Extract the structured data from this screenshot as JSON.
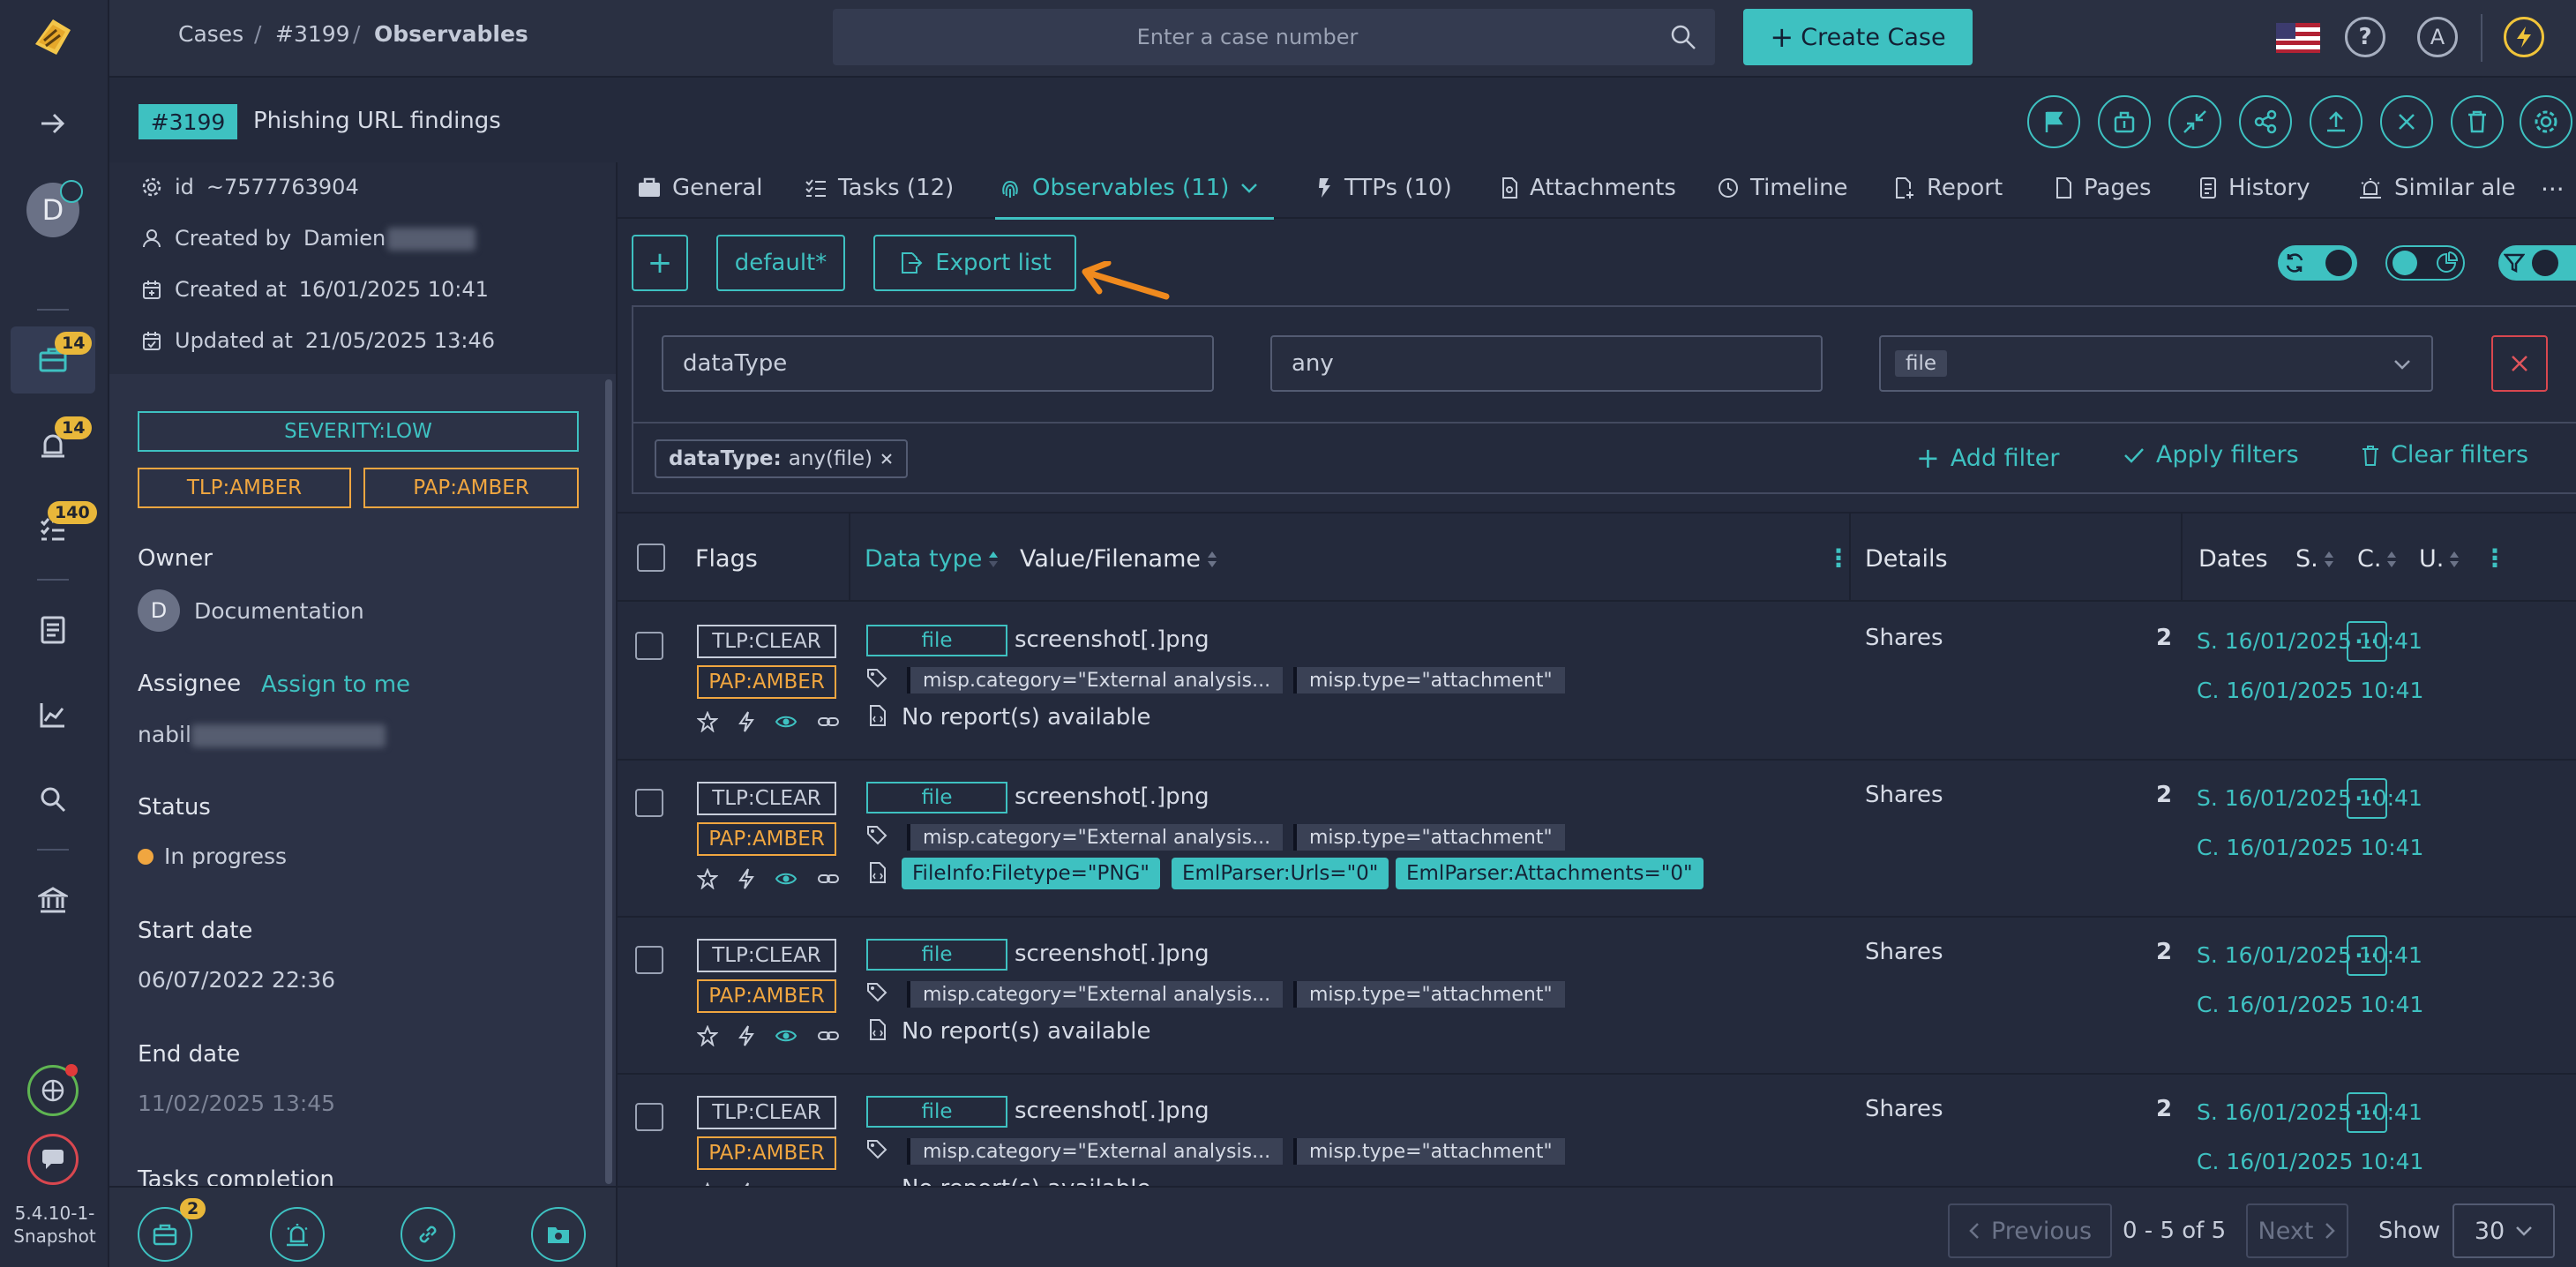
{
  "nav": {
    "breadcrumb": [
      "Cases",
      "/",
      "#3199",
      "/",
      "Observables"
    ],
    "search_placeholder": "Enter a case number",
    "create_case": "Create Case",
    "avatar_letter": "A",
    "badges": {
      "cases": "14",
      "alerts": "14",
      "tasks": "140"
    },
    "user_letter": "D",
    "version": "5.4.10-1-Snapshot",
    "footer_badge": "2"
  },
  "case": {
    "number": "#3199",
    "title": "Phishing URL findings",
    "id": "~7577763904",
    "created_by_label": "Created by",
    "created_by": "Damien",
    "created_at_label": "Created at",
    "created_at": "16/01/2025 10:41",
    "updated_at_label": "Updated at",
    "updated_at": "21/05/2025 13:46",
    "severity": "SEVERITY:LOW",
    "tlp": "TLP:AMBER",
    "pap": "PAP:AMBER",
    "owner_label": "Owner",
    "owner_letter": "D",
    "owner": "Documentation",
    "assignee_label": "Assignee",
    "assign_to_me": "Assign to me",
    "assignee": "nabil",
    "status_label": "Status",
    "status": "In progress",
    "start_date_label": "Start date",
    "start_date": "06/07/2022 22:36",
    "end_date_label": "End date",
    "end_date": "11/02/2025 13:45",
    "tasks_completion_label": "Tasks completion"
  },
  "tabs": [
    {
      "label": "General"
    },
    {
      "label": "Tasks (12)"
    },
    {
      "label": "Observables (11)"
    },
    {
      "label": "TTPs (10)"
    },
    {
      "label": "Attachments"
    },
    {
      "label": "Timeline"
    },
    {
      "label": "Report"
    },
    {
      "label": "Pages"
    },
    {
      "label": "History"
    },
    {
      "label": "Similar ale"
    }
  ],
  "toolbar": {
    "add": "+",
    "preset": "default*",
    "export": "Export list"
  },
  "filter": {
    "field": "dataType",
    "operator": "any",
    "value": "file",
    "chip_key": "dataType:",
    "chip_value": "any(file)",
    "add_filter": "Add filter",
    "apply_filters": "Apply filters",
    "clear_filters": "Clear filters"
  },
  "table": {
    "headers": {
      "flags": "Flags",
      "data_type": "Data type",
      "value": "Value/Filename",
      "details": "Details",
      "dates": "Dates",
      "s": "S.",
      "c": "C.",
      "u": "U."
    },
    "rows": [
      {
        "tlp": "TLP:CLEAR",
        "pap": "PAP:AMBER",
        "type": "file",
        "name": "screenshot[.]png",
        "tag1": "misp.category=\"External analysis...",
        "tag2": "misp.type=\"attachment\"",
        "report": "No report(s) available",
        "shares_label": "Shares",
        "shares": "2",
        "s_date": "S. 16/01/2025 10:41",
        "c_date": "C. 16/01/2025 10:41"
      },
      {
        "tlp": "TLP:CLEAR",
        "pap": "PAP:AMBER",
        "type": "file",
        "name": "screenshot[.]png",
        "tag1": "misp.category=\"External analysis...",
        "tag2": "misp.type=\"attachment\"",
        "reports": [
          "FileInfo:Filetype=\"PNG\"",
          "EmlParser:Urls=\"0\"",
          "EmlParser:Attachments=\"0\""
        ],
        "shares_label": "Shares",
        "shares": "2",
        "s_date": "S. 16/01/2025 10:41",
        "c_date": "C. 16/01/2025 10:41"
      },
      {
        "tlp": "TLP:CLEAR",
        "pap": "PAP:AMBER",
        "type": "file",
        "name": "screenshot[.]png",
        "tag1": "misp.category=\"External analysis...",
        "tag2": "misp.type=\"attachment\"",
        "report": "No report(s) available",
        "shares_label": "Shares",
        "shares": "2",
        "s_date": "S. 16/01/2025 10:41",
        "c_date": "C. 16/01/2025 10:41"
      },
      {
        "tlp": "TLP:CLEAR",
        "pap": "PAP:AMBER",
        "type": "file",
        "name": "screenshot[.]png",
        "tag1": "misp.category=\"External analysis...",
        "tag2": "misp.type=\"attachment\"",
        "report": "No report(s) available",
        "shares_label": "Shares",
        "shares": "2",
        "s_date": "S. 16/01/2025 10:41",
        "c_date": "C. 16/01/2025 10:41"
      }
    ]
  },
  "pagination": {
    "previous": "Previous",
    "range": "0 - 5 of 5",
    "next": "Next",
    "show_label": "Show",
    "page_size": "30"
  },
  "colors": {
    "accent": "#3ec1c1",
    "amber": "#f0a640",
    "danger": "#d9474f",
    "background": "#242a3c"
  }
}
